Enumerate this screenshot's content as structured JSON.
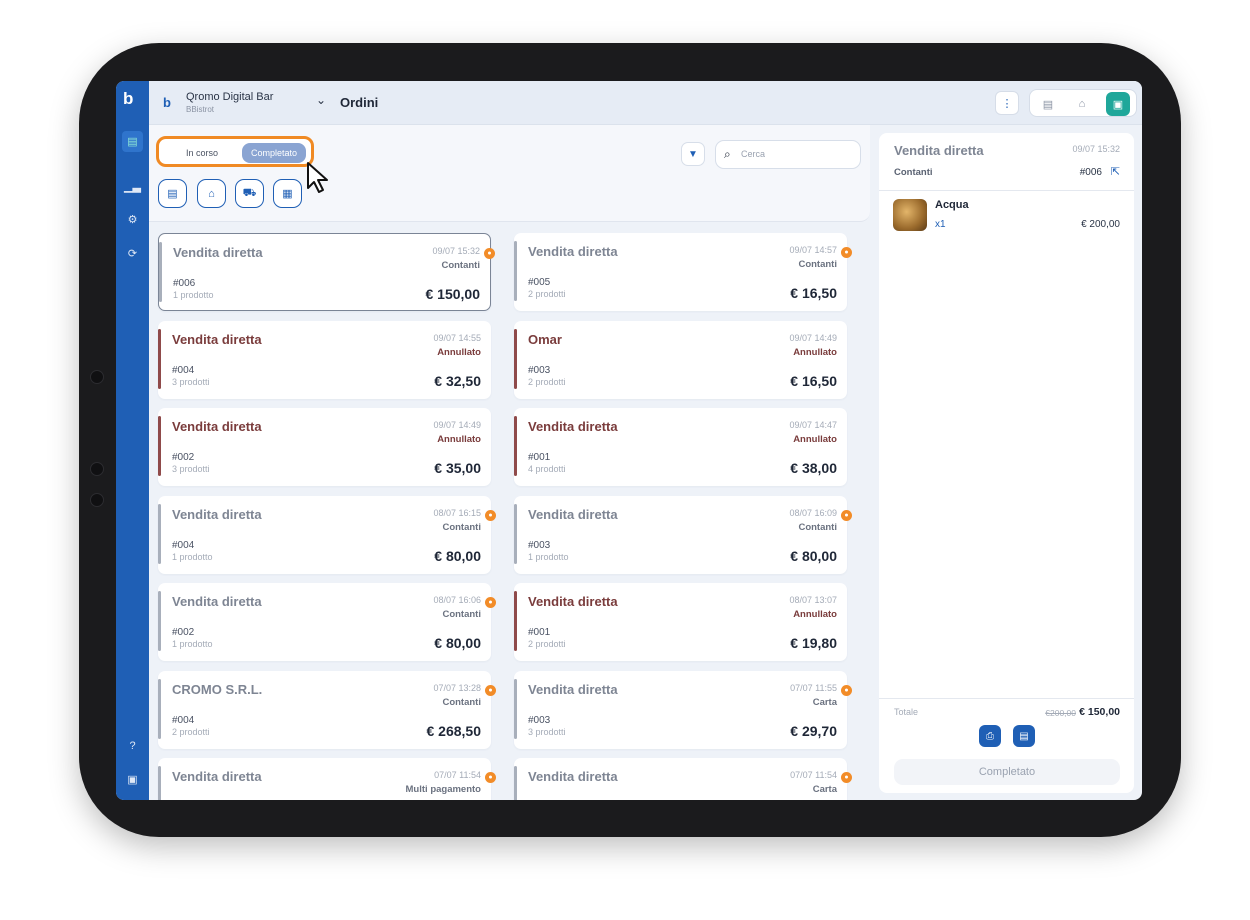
{
  "venue": {
    "name": "Qromo Digital Bar",
    "subtitle": "BBistrot"
  },
  "page_title": "Ordini",
  "status_tabs": {
    "in_progress": "In corso",
    "completed": "Completato"
  },
  "search": {
    "placeholder": "Cerca"
  },
  "orders": [
    {
      "name": "Vendita diretta",
      "time": "09/07 15:32",
      "status": "Contanti",
      "number": "#006",
      "products": "1 prodotto",
      "total": "€ 150,00",
      "cancelled": false
    },
    {
      "name": "Vendita diretta",
      "time": "09/07 14:57",
      "status": "Contanti",
      "number": "#005",
      "products": "2 prodotti",
      "total": "€ 16,50",
      "cancelled": false
    },
    {
      "name": "Vendita diretta",
      "time": "09/07 14:55",
      "status": "Annullato",
      "number": "#004",
      "products": "3 prodotti",
      "total": "€ 32,50",
      "cancelled": true
    },
    {
      "name": "Omar",
      "time": "09/07 14:49",
      "status": "Annullato",
      "number": "#003",
      "products": "2 prodotti",
      "total": "€ 16,50",
      "cancelled": true
    },
    {
      "name": "Vendita diretta",
      "time": "09/07 14:49",
      "status": "Annullato",
      "number": "#002",
      "products": "3 prodotti",
      "total": "€ 35,00",
      "cancelled": true
    },
    {
      "name": "Vendita diretta",
      "time": "09/07 14:47",
      "status": "Annullato",
      "number": "#001",
      "products": "4 prodotti",
      "total": "€ 38,00",
      "cancelled": true
    },
    {
      "name": "Vendita diretta",
      "time": "08/07 16:15",
      "status": "Contanti",
      "number": "#004",
      "products": "1 prodotto",
      "total": "€ 80,00",
      "cancelled": false
    },
    {
      "name": "Vendita diretta",
      "time": "08/07 16:09",
      "status": "Contanti",
      "number": "#003",
      "products": "1 prodotto",
      "total": "€ 80,00",
      "cancelled": false
    },
    {
      "name": "Vendita diretta",
      "time": "08/07 16:06",
      "status": "Contanti",
      "number": "#002",
      "products": "1 prodotto",
      "total": "€ 80,00",
      "cancelled": false
    },
    {
      "name": "Vendita diretta",
      "time": "08/07 13:07",
      "status": "Annullato",
      "number": "#001",
      "products": "2 prodotti",
      "total": "€ 19,80",
      "cancelled": true
    },
    {
      "name": "CROMO S.R.L.",
      "time": "07/07 13:28",
      "status": "Contanti",
      "number": "#004",
      "products": "2 prodotti",
      "total": "€ 268,50",
      "cancelled": false
    },
    {
      "name": "Vendita diretta",
      "time": "07/07 11:55",
      "status": "Carta",
      "number": "#003",
      "products": "3 prodotti",
      "total": "€ 29,70",
      "cancelled": false
    },
    {
      "name": "Vendita diretta",
      "time": "07/07 11:54",
      "status": "Multi pagamento",
      "number": "",
      "products": "",
      "total": "",
      "cancelled": false
    },
    {
      "name": "Vendita diretta",
      "time": "07/07 11:54",
      "status": "Carta",
      "number": "",
      "products": "",
      "total": "",
      "cancelled": false
    }
  ],
  "detail": {
    "title": "Vendita diretta",
    "time": "09/07 15:32",
    "payment": "Contanti",
    "number": "#006",
    "item": {
      "name": "Acqua",
      "qty": "x1",
      "price": "€ 200,00"
    },
    "total_label": "Totale",
    "total_old": "€200,00",
    "total_new": "€ 150,00",
    "complete_label": "Completato"
  },
  "colors": {
    "brand": "#1f5fb5",
    "highlight": "#f08a24",
    "cancelled": "#7a3c3c",
    "badge": "#f28c28"
  }
}
